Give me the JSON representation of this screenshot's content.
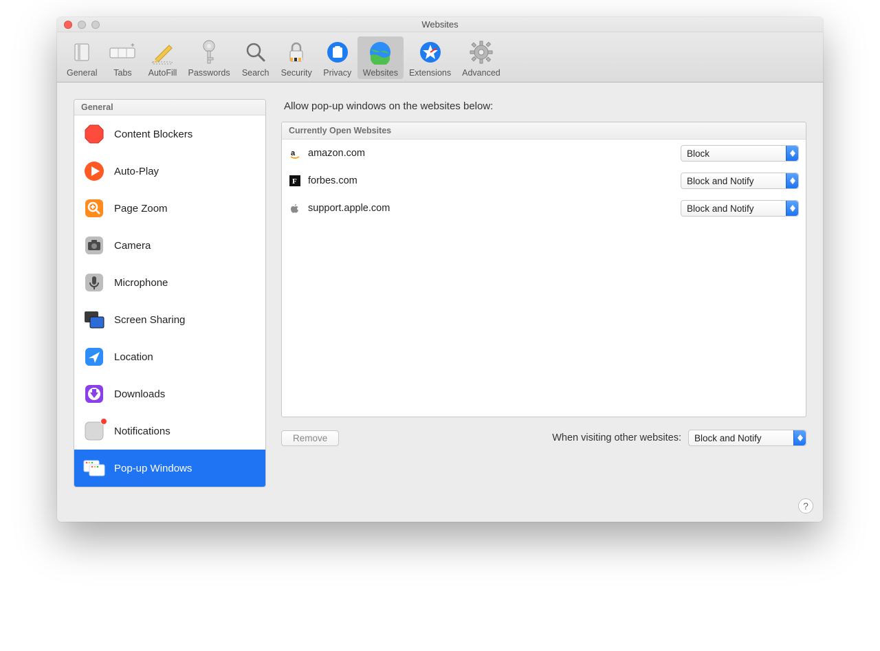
{
  "window": {
    "title": "Websites"
  },
  "toolbar": {
    "items": [
      {
        "label": "General"
      },
      {
        "label": "Tabs"
      },
      {
        "label": "AutoFill"
      },
      {
        "label": "Passwords"
      },
      {
        "label": "Search"
      },
      {
        "label": "Security"
      },
      {
        "label": "Privacy"
      },
      {
        "label": "Websites"
      },
      {
        "label": "Extensions"
      },
      {
        "label": "Advanced"
      }
    ],
    "selected_index": 7
  },
  "sidebar": {
    "header": "General",
    "items": [
      {
        "label": "Content Blockers"
      },
      {
        "label": "Auto-Play"
      },
      {
        "label": "Page Zoom"
      },
      {
        "label": "Camera"
      },
      {
        "label": "Microphone"
      },
      {
        "label": "Screen Sharing"
      },
      {
        "label": "Location"
      },
      {
        "label": "Downloads"
      },
      {
        "label": "Notifications"
      },
      {
        "label": "Pop-up Windows"
      }
    ],
    "selected_index": 9
  },
  "main": {
    "heading": "Allow pop-up windows on the websites below:",
    "table_header": "Currently Open Websites",
    "rows": [
      {
        "domain": "amazon.com",
        "policy": "Block"
      },
      {
        "domain": "forbes.com",
        "policy": "Block and Notify"
      },
      {
        "domain": "support.apple.com",
        "policy": "Block and Notify"
      }
    ],
    "remove_label": "Remove",
    "default_label": "When visiting other websites:",
    "default_policy": "Block and Notify"
  },
  "help": {
    "symbol": "?"
  }
}
